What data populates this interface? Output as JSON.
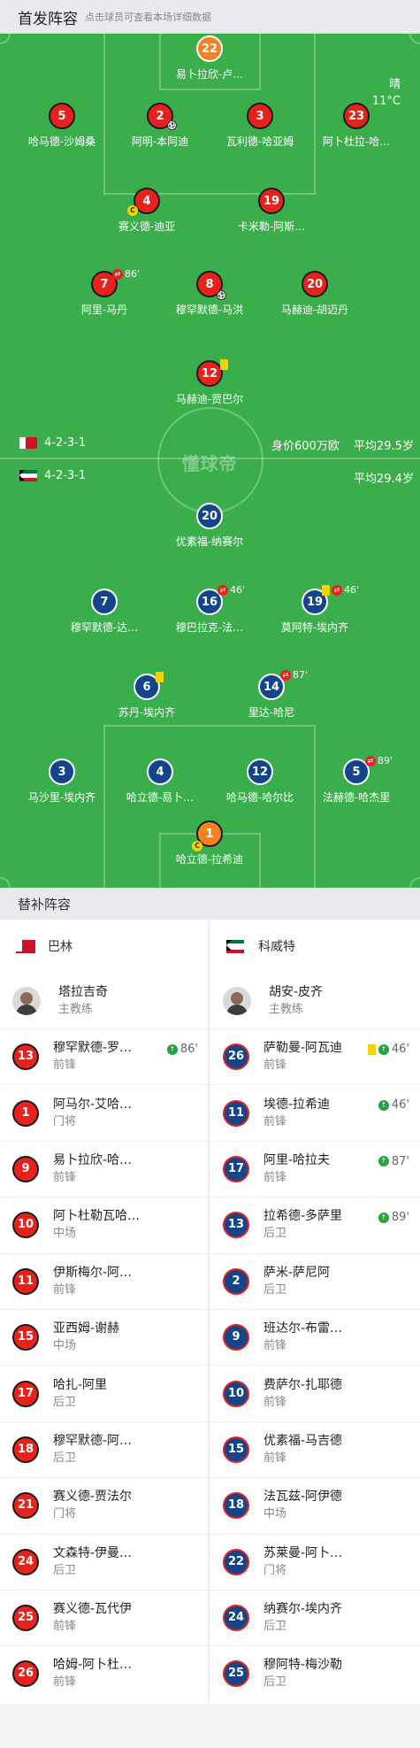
{
  "header": {
    "title": "首发阵容",
    "subtitle": "点击球员可查看本场详细数据"
  },
  "weather": {
    "condition": "晴",
    "temperature": "11°C"
  },
  "watermark": "懂球帝",
  "home": {
    "formation": "4-2-3-1",
    "market_value": "身价600万欧",
    "avg_age": "平均29.5岁",
    "players": [
      {
        "number": "22",
        "name": "易卜拉欣-卢…"
      },
      {
        "number": "5",
        "name": "哈马德-沙姆桑"
      },
      {
        "number": "2",
        "name": "阿明-本阿迪"
      },
      {
        "number": "3",
        "name": "瓦利德-哈亚姆"
      },
      {
        "number": "23",
        "name": "阿卜杜拉-哈…"
      },
      {
        "number": "4",
        "name": "赛义德-迪亚"
      },
      {
        "number": "19",
        "name": "卡米勒-阿斯…"
      },
      {
        "number": "7",
        "name": "阿里-马丹",
        "event_time": "86'"
      },
      {
        "number": "8",
        "name": "穆罕默德-马洪"
      },
      {
        "number": "20",
        "name": "马赫迪-胡迈丹"
      },
      {
        "number": "12",
        "name": "马赫迪-贾巴尔"
      }
    ]
  },
  "away": {
    "formation": "4-2-3-1",
    "avg_age": "平均29.4岁",
    "players": [
      {
        "number": "20",
        "name": "优素福-纳赛尔"
      },
      {
        "number": "7",
        "name": "穆罕默德-达…"
      },
      {
        "number": "16",
        "name": "穆巴拉克-法…",
        "event_time": "46'"
      },
      {
        "number": "19",
        "name": "莫阿特-埃内齐",
        "event_time": "46'"
      },
      {
        "number": "6",
        "name": "苏丹-埃内齐"
      },
      {
        "number": "14",
        "name": "里达-哈尼",
        "event_time": "87'"
      },
      {
        "number": "3",
        "name": "马沙里-埃内齐"
      },
      {
        "number": "4",
        "name": "哈立德-易卜…"
      },
      {
        "number": "12",
        "name": "哈马德-哈尔比"
      },
      {
        "number": "5",
        "name": "法赫德-哈杰里",
        "event_time": "89'"
      },
      {
        "number": "1",
        "name": "哈立德-拉希迪"
      }
    ]
  },
  "subs_header": "替补阵容",
  "subs": {
    "home": {
      "team": "巴林",
      "coach": {
        "name": "塔拉吉奇",
        "role": "主教练"
      },
      "players": [
        {
          "number": "13",
          "name": "穆罕默德-罗…",
          "pos": "前锋",
          "time": "86'"
        },
        {
          "number": "1",
          "name": "阿马尔-艾哈…",
          "pos": "门将"
        },
        {
          "number": "9",
          "name": "易卜拉欣-哈…",
          "pos": "前锋"
        },
        {
          "number": "10",
          "name": "阿卜杜勒瓦哈…",
          "pos": "中场"
        },
        {
          "number": "11",
          "name": "伊斯梅尔-阿…",
          "pos": "前锋"
        },
        {
          "number": "15",
          "name": "亚西姆-谢赫",
          "pos": "中场"
        },
        {
          "number": "17",
          "name": "哈扎-阿里",
          "pos": "后卫"
        },
        {
          "number": "18",
          "name": "穆罕默德-阿…",
          "pos": "后卫"
        },
        {
          "number": "21",
          "name": "赛义德-贾法尔",
          "pos": "门将"
        },
        {
          "number": "24",
          "name": "文森特-伊曼…",
          "pos": "后卫"
        },
        {
          "number": "25",
          "name": "赛义德-瓦代伊",
          "pos": "前锋"
        },
        {
          "number": "26",
          "name": "哈姆-阿卜杜…",
          "pos": "前锋"
        }
      ]
    },
    "away": {
      "team": "科威特",
      "coach": {
        "name": "胡安-皮齐",
        "role": "主教练"
      },
      "players": [
        {
          "number": "26",
          "name": "萨勒曼-阿瓦迪",
          "pos": "前锋",
          "time": "46'"
        },
        {
          "number": "11",
          "name": "埃德-拉希迪",
          "pos": "前锋",
          "time": "46'"
        },
        {
          "number": "17",
          "name": "阿里-哈拉夫",
          "pos": "前锋",
          "time": "87'"
        },
        {
          "number": "13",
          "name": "拉希德-多萨里",
          "pos": "后卫",
          "time": "89'"
        },
        {
          "number": "2",
          "name": "萨米-萨尼阿",
          "pos": "后卫"
        },
        {
          "number": "9",
          "name": "班达尔-布雷…",
          "pos": "前锋"
        },
        {
          "number": "10",
          "name": "费萨尔-扎耶德",
          "pos": "前锋"
        },
        {
          "number": "15",
          "name": "优素福-马吉德",
          "pos": "前锋"
        },
        {
          "number": "18",
          "name": "法瓦兹-阿伊德",
          "pos": "中场"
        },
        {
          "number": "22",
          "name": "苏莱曼-阿卜…",
          "pos": "门将"
        },
        {
          "number": "24",
          "name": "纳赛尔-埃内齐",
          "pos": "后卫"
        },
        {
          "number": "25",
          "name": "穆阿特-梅沙勒",
          "pos": "后卫"
        }
      ]
    }
  },
  "colors": {
    "pitch": "#3bae4c",
    "home_kit": "#e8211a",
    "away_kit": "#14448a",
    "goalkeeper": "#f58220",
    "yellow_card": "#f5d300",
    "sub_in": "#25a244"
  },
  "icons": {
    "sub_off": "sub-off-icon",
    "sub_on": "sub-on-icon",
    "yellow_card": "yellow-card-icon",
    "goal": "goal-ball-icon",
    "captain": "captain-icon"
  }
}
